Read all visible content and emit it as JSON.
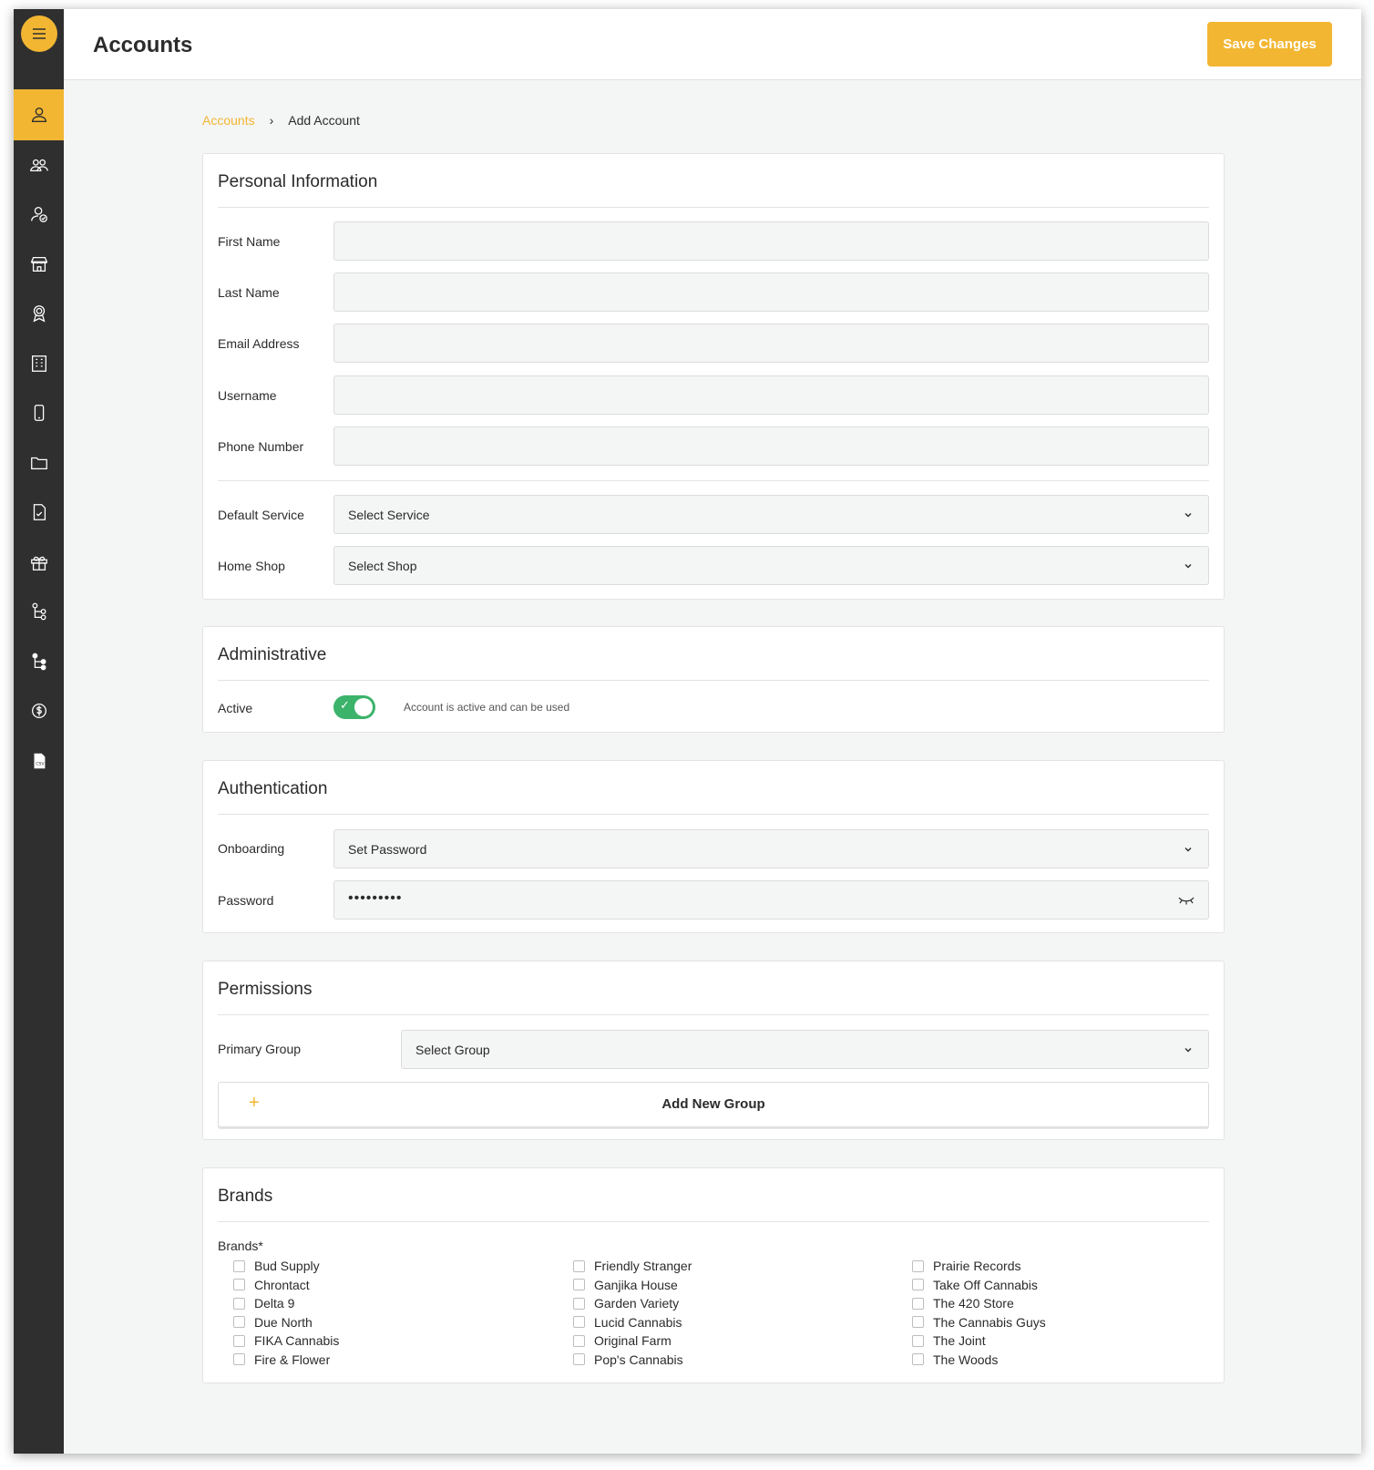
{
  "header": {
    "title": "Accounts",
    "save_label": "Save Changes"
  },
  "sidebar": {
    "items": [
      {
        "icon": "user-icon",
        "active": true
      },
      {
        "icon": "users-group-icon",
        "active": false
      },
      {
        "icon": "user-check-icon",
        "active": false
      },
      {
        "icon": "storefront-icon",
        "active": false
      },
      {
        "icon": "award-badge-icon",
        "active": false
      },
      {
        "icon": "building-icon",
        "active": false
      },
      {
        "icon": "mobile-device-icon",
        "active": false
      },
      {
        "icon": "folder-icon",
        "active": false
      },
      {
        "icon": "document-check-icon",
        "active": false
      },
      {
        "icon": "gift-icon",
        "active": false
      },
      {
        "icon": "hierarchy-icon",
        "active": false
      },
      {
        "icon": "hierarchy-filled-icon",
        "active": false
      },
      {
        "icon": "dollar-coin-icon",
        "active": false
      },
      {
        "icon": "csv-file-icon",
        "active": false
      }
    ]
  },
  "breadcrumb": {
    "parent": "Accounts",
    "separator": "›",
    "current": "Add Account"
  },
  "personal": {
    "title": "Personal Information",
    "first_name_label": "First Name",
    "first_name_value": "",
    "last_name_label": "Last Name",
    "last_name_value": "",
    "email_label": "Email Address",
    "email_value": "",
    "username_label": "Username",
    "username_value": "",
    "phone_label": "Phone Number",
    "phone_value": "",
    "service_label": "Default Service",
    "service_value": "Select Service",
    "shop_label": "Home Shop",
    "shop_value": "Select Shop"
  },
  "administrative": {
    "title": "Administrative",
    "active_label": "Active",
    "active_on": true,
    "active_desc": "Account is active and can be used"
  },
  "authentication": {
    "title": "Authentication",
    "onboarding_label": "Onboarding",
    "onboarding_value": "Set Password",
    "password_label": "Password",
    "password_value": "•••••••••"
  },
  "permissions": {
    "title": "Permissions",
    "primary_group_label": "Primary Group",
    "primary_group_value": "Select Group",
    "add_group_plus": "+",
    "add_group_label": "Add New Group"
  },
  "brands": {
    "title": "Brands",
    "label": "Brands*",
    "columns": [
      [
        "Bud Supply",
        "Chrontact",
        "Delta 9",
        "Due North",
        "FIKA Cannabis",
        "Fire & Flower"
      ],
      [
        "Friendly Stranger",
        "Ganjika House",
        "Garden Variety",
        "Lucid Cannabis",
        "Original Farm",
        "Pop's Cannabis"
      ],
      [
        "Prairie Records",
        "Take Off Cannabis",
        "The 420 Store",
        "The Cannabis Guys",
        "The Joint",
        "The Woods"
      ]
    ]
  },
  "colors": {
    "accent": "#f2b632",
    "sidebar": "#2f2f2f",
    "toggle_on": "#3bb36a"
  }
}
